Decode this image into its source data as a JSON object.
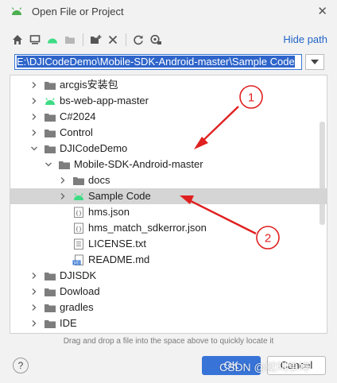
{
  "window": {
    "title": "Open File or Project"
  },
  "toolbar": {
    "icons": [
      "home-icon",
      "desktop-icon",
      "project-icon",
      "module-icon",
      "new-folder-icon",
      "delete-icon",
      "refresh-icon",
      "show-hidden-icon"
    ],
    "hide_path": "Hide path"
  },
  "path": {
    "value": "E:\\DJICodeDemo\\Mobile-SDK-Android-master\\Sample Code"
  },
  "tree": {
    "rows": [
      {
        "label": "arcgis安装包",
        "icon": "folder",
        "chevron": "right"
      },
      {
        "label": "bs-web-app-master",
        "icon": "android",
        "chevron": "right"
      },
      {
        "label": "C#2024",
        "icon": "folder",
        "chevron": "right"
      },
      {
        "label": "Control",
        "icon": "folder",
        "chevron": "right"
      },
      {
        "label": "DJICodeDemo",
        "icon": "folder",
        "chevron": "down"
      },
      {
        "label": "Mobile-SDK-Android-master",
        "icon": "folder",
        "chevron": "down"
      },
      {
        "label": "docs",
        "icon": "folder",
        "chevron": "right"
      },
      {
        "label": "Sample Code",
        "icon": "android",
        "chevron": "right",
        "selected": true
      },
      {
        "label": "hms.json",
        "icon": "json",
        "chevron": ""
      },
      {
        "label": "hms_match_sdkerror.json",
        "icon": "json",
        "chevron": ""
      },
      {
        "label": "LICENSE.txt",
        "icon": "text",
        "chevron": ""
      },
      {
        "label": "README.md",
        "icon": "md",
        "chevron": ""
      },
      {
        "label": "DJISDK",
        "icon": "folder",
        "chevron": "right"
      },
      {
        "label": "Dowload",
        "icon": "folder",
        "chevron": "right"
      },
      {
        "label": "gradles",
        "icon": "folder",
        "chevron": "right"
      },
      {
        "label": "IDE",
        "icon": "folder",
        "chevron": "right"
      }
    ]
  },
  "hint": "Drag and drop a file into the space above to quickly locate it",
  "buttons": {
    "help": "?",
    "ok": "OK",
    "cancel": "Cancel"
  },
  "watermark": "CSDN @就叫单坤",
  "annotations": [
    "1",
    "2"
  ],
  "colors": {
    "accent": "#3874d8",
    "link": "#2264c7",
    "annotation": "#e02020",
    "android": "#3ddc84"
  }
}
